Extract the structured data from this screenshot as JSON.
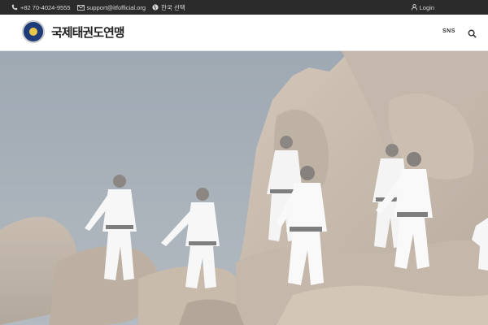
{
  "topbar": {
    "phone": "+82 70-4024-9555",
    "email": "support@itfofficial.org",
    "language": "한국 선택",
    "login": "Login"
  },
  "header": {
    "logo_text": "국제태권도연맹",
    "sns_label": "SNS"
  },
  "icons": {
    "phone": "phone-icon",
    "email": "envelope-icon",
    "language": "globe-icon",
    "login": "user-icon",
    "search": "search-icon"
  },
  "colors": {
    "topbar_bg": "#2b2b2b",
    "emblem_blue": "#1e3c7a",
    "emblem_gold": "#e8c64a"
  }
}
